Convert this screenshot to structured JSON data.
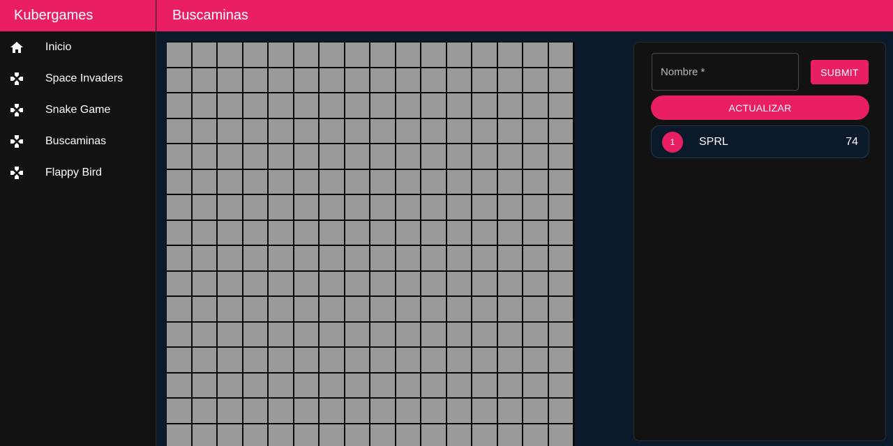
{
  "app": {
    "brand": "Kubergames"
  },
  "header": {
    "title": "Buscaminas"
  },
  "sidebar": {
    "items": [
      {
        "label": "Inicio",
        "icon": "home-icon"
      },
      {
        "label": "Space Invaders",
        "icon": "gamepad-icon"
      },
      {
        "label": "Snake Game",
        "icon": "gamepad-icon"
      },
      {
        "label": "Buscaminas",
        "icon": "gamepad-icon"
      },
      {
        "label": "Flappy Bird",
        "icon": "gamepad-icon"
      }
    ]
  },
  "board": {
    "columns": 16,
    "visible_rows": 16,
    "cell_state": "covered"
  },
  "form": {
    "name_placeholder": "Nombre *",
    "name_value": "",
    "submit_label": "SUBMIT",
    "update_label": "ACTUALIZAR"
  },
  "scores": [
    {
      "rank": "1",
      "name": "SPRL",
      "score": "74"
    }
  ],
  "colors": {
    "accent": "#e91e63",
    "sidebar_bg": "#121212",
    "content_bg": "#0b1a2b",
    "cell_covered": "#9a9a9a"
  }
}
